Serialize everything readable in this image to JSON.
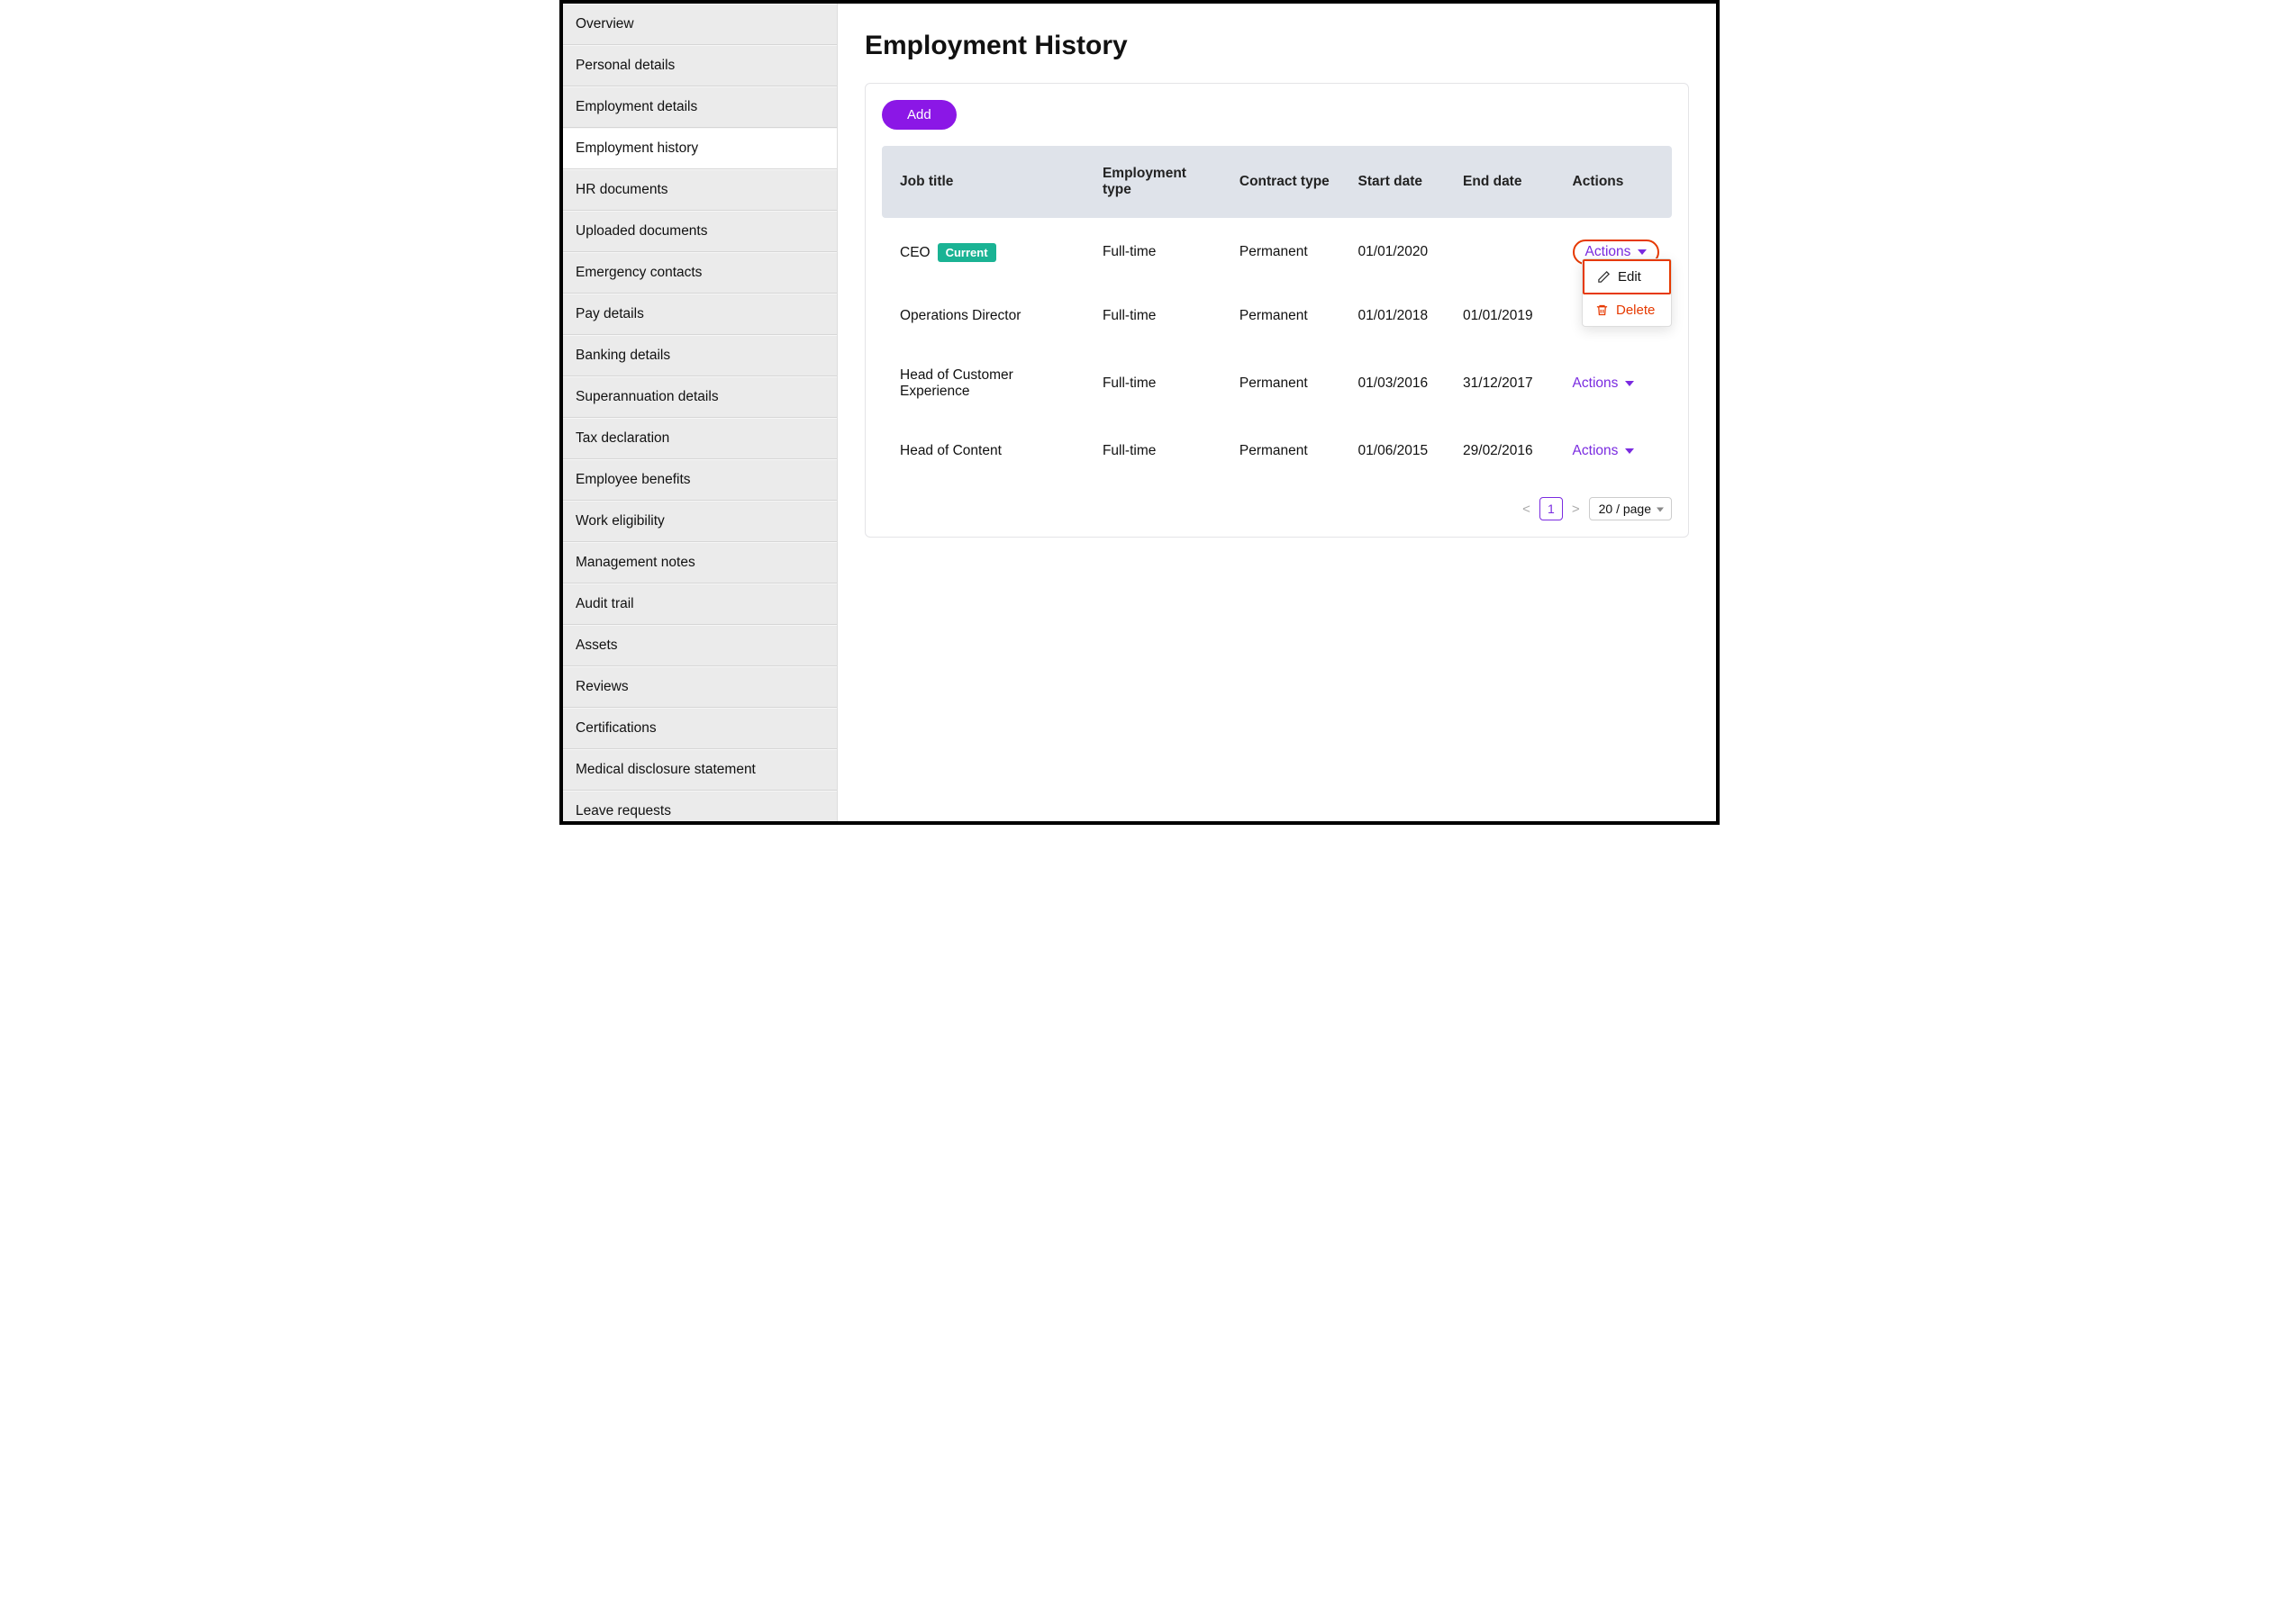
{
  "sidebar": {
    "items": [
      {
        "label": "Overview",
        "active": false
      },
      {
        "label": "Personal details",
        "active": false
      },
      {
        "label": "Employment details",
        "active": false
      },
      {
        "label": "Employment history",
        "active": true
      },
      {
        "label": "HR documents",
        "active": false
      },
      {
        "label": "Uploaded documents",
        "active": false
      },
      {
        "label": "Emergency contacts",
        "active": false
      },
      {
        "label": "Pay details",
        "active": false
      },
      {
        "label": "Banking details",
        "active": false
      },
      {
        "label": "Superannuation details",
        "active": false
      },
      {
        "label": "Tax declaration",
        "active": false
      },
      {
        "label": "Employee benefits",
        "active": false
      },
      {
        "label": "Work eligibility",
        "active": false
      },
      {
        "label": "Management notes",
        "active": false
      },
      {
        "label": "Audit trail",
        "active": false
      },
      {
        "label": "Assets",
        "active": false
      },
      {
        "label": "Reviews",
        "active": false
      },
      {
        "label": "Certifications",
        "active": false
      },
      {
        "label": "Medical disclosure statement",
        "active": false
      },
      {
        "label": "Leave requests",
        "active": false
      }
    ]
  },
  "main": {
    "title": "Employment History",
    "add_label": "Add",
    "columns": {
      "job_title": "Job title",
      "employment_type": "Employment type",
      "contract_type": "Contract type",
      "start_date": "Start date",
      "end_date": "End date",
      "actions": "Actions"
    },
    "rows": [
      {
        "job_title": "CEO",
        "badge": "Current",
        "employment_type": "Full-time",
        "contract_type": "Permanent",
        "start_date": "01/01/2020",
        "end_date": "",
        "actions_label": "Actions",
        "highlighted": true
      },
      {
        "job_title": "Operations Director",
        "badge": "",
        "employment_type": "Full-time",
        "contract_type": "Permanent",
        "start_date": "01/01/2018",
        "end_date": "01/01/2019",
        "actions_label": "",
        "highlighted": false
      },
      {
        "job_title": "Head of Customer Experience",
        "badge": "",
        "employment_type": "Full-time",
        "contract_type": "Permanent",
        "start_date": "01/03/2016",
        "end_date": "31/12/2017",
        "actions_label": "Actions",
        "highlighted": false
      },
      {
        "job_title": "Head of Content",
        "badge": "",
        "employment_type": "Full-time",
        "contract_type": "Permanent",
        "start_date": "01/06/2015",
        "end_date": "29/02/2016",
        "actions_label": "Actions",
        "highlighted": false
      }
    ],
    "dropdown": {
      "edit": "Edit",
      "delete": "Delete"
    },
    "pagination": {
      "prev": "<",
      "page": "1",
      "next": ">",
      "page_size": "20 / page"
    }
  }
}
